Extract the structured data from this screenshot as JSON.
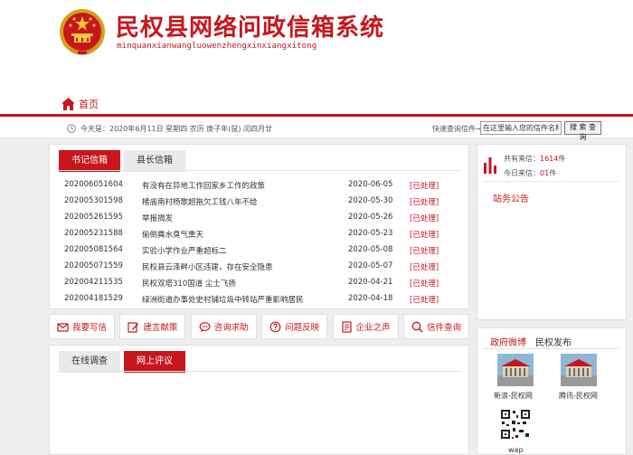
{
  "header": {
    "title": "民权县网络问政信箱系统",
    "pinyin": "minquanxianwangluowenzhengxinxiangxitong"
  },
  "nav": {
    "home": "首页"
  },
  "infobar": {
    "today": "今天是：2020年6月11日 星期四 农历 庚子年(鼠) 闰四月廿",
    "query_label": "快速查询信件→",
    "query_input_value": "在这里输入您的信件名称",
    "query_button": "搜 索 查 询"
  },
  "mail": {
    "tabs": [
      "书记信箱",
      "县长信箱"
    ],
    "rows": [
      {
        "id": "202006051604",
        "title": "有没有在异地工作回家乡工作的政策",
        "date": "2020-06-05",
        "status": "[已处理]"
      },
      {
        "id": "202005301598",
        "title": "楮庙南村杨歌超拖欠工钱八年不给",
        "date": "2020-05-30",
        "status": "[已处理]"
      },
      {
        "id": "202005261595",
        "title": "举报揭发",
        "date": "2020-05-26",
        "status": "[已处理]"
      },
      {
        "id": "202005231588",
        "title": "偷倒粪水臭气熏天",
        "date": "2020-05-23",
        "status": "[已处理]"
      },
      {
        "id": "202005081564",
        "title": "实验小学作业严重超标二",
        "date": "2020-05-08",
        "status": "[已处理]"
      },
      {
        "id": "202005071559",
        "title": "民权县云泽畔小区违建，存在安全隐患",
        "date": "2020-05-07",
        "status": "[已处理]"
      },
      {
        "id": "202004211535",
        "title": "民权双塔310国道 尘土飞扬",
        "date": "2020-04-21",
        "status": "[已处理]"
      },
      {
        "id": "202004181529",
        "title": "绿洲街道办事处史村铺垃圾中转站严重影响居民",
        "date": "2020-04-18",
        "status": "[已处理]"
      }
    ]
  },
  "actions": [
    "我要写信",
    "建言献策",
    "咨询求助",
    "问题反映",
    "企业之声",
    "信件查询"
  ],
  "survey": {
    "tabs": [
      "在线调查",
      "网上评议"
    ]
  },
  "stats": {
    "total_label": "共有来信：",
    "total_value": "1614",
    "today_label": "今日来信：",
    "today_value": "01",
    "unit": "件",
    "notice_title": "站务公告"
  },
  "weibo": {
    "tabs": [
      "政府微博",
      "民权发布"
    ],
    "items": [
      "新浪-民权网",
      "腾讯-民权网"
    ],
    "wap_label": "wap"
  },
  "colors": {
    "accent": "#c8161d",
    "background": "#eeeeee"
  }
}
